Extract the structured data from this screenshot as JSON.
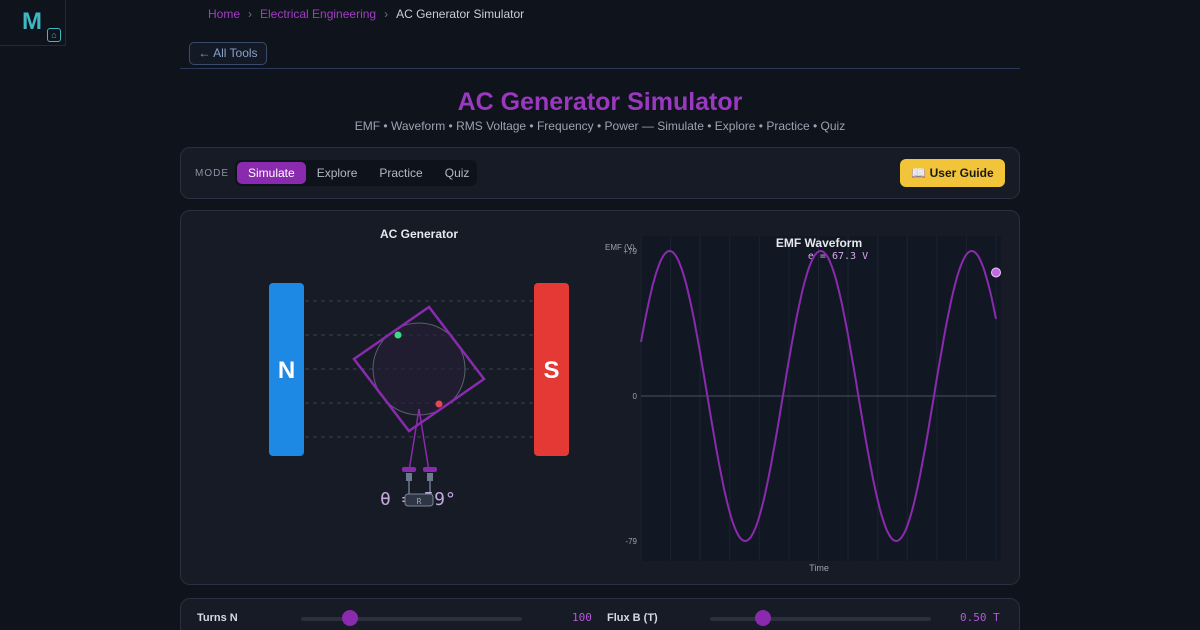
{
  "logo": {
    "letter": "M"
  },
  "breadcrumb": {
    "home": "Home",
    "sep": "›",
    "category": "Electrical Engineering",
    "current": "AC Generator Simulator"
  },
  "nav": {
    "all_tools": "← All Tools"
  },
  "header": {
    "title": "AC Generator Simulator",
    "subtitle": "EMF • Waveform • RMS Voltage • Frequency • Power — Simulate • Explore • Practice • Quiz"
  },
  "mode": {
    "label": "MODE",
    "tabs": [
      "Simulate",
      "Explore",
      "Practice",
      "Quiz"
    ],
    "active": "Simulate",
    "guide_label": "📖 User Guide"
  },
  "generator": {
    "title": "AC Generator",
    "north_label": "N",
    "south_label": "S",
    "resistor_label": "R",
    "angle_readout": "θ = 59°"
  },
  "colors": {
    "accent": "#8a2aae",
    "north": "#1e88e5",
    "south": "#e53935",
    "guide": "#f2c43a",
    "waveform": "#8a2aae"
  },
  "chart_data": {
    "type": "line",
    "title": "EMF Waveform",
    "ylabel": "EMF (V)",
    "xlabel": "Time",
    "annotation": "e = 67.3 V",
    "ylim": [
      -79,
      79
    ],
    "yticks": [
      "+79",
      "0",
      "-79"
    ],
    "amplitude": 79,
    "cycles": 2.35,
    "phase_deg": 59,
    "current_value": 67.3,
    "grid": true
  },
  "controls": {
    "turns": {
      "label": "Turns N",
      "value": "100",
      "fraction": 0.22
    },
    "flux": {
      "label": "Flux B (T)",
      "value": "0.50 T",
      "fraction": 0.24
    }
  }
}
